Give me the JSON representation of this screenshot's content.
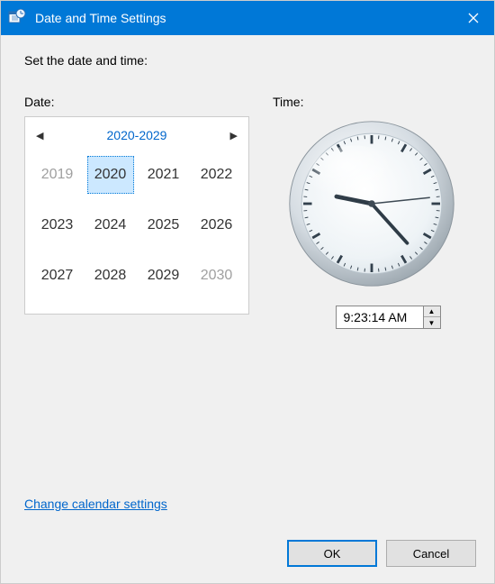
{
  "window": {
    "title": "Date and Time Settings"
  },
  "instruction": "Set the date and time:",
  "date": {
    "label": "Date:",
    "range_title": "2020-2029",
    "years": [
      "2019",
      "2020",
      "2021",
      "2022",
      "2023",
      "2024",
      "2025",
      "2026",
      "2027",
      "2028",
      "2029",
      "2030"
    ],
    "selected": "2020",
    "outside": [
      "2019",
      "2030"
    ]
  },
  "time": {
    "label": "Time:",
    "value": "9:23:14 AM",
    "hour": 9,
    "minute": 23,
    "second": 14
  },
  "link": "Change calendar settings",
  "buttons": {
    "ok": "OK",
    "cancel": "Cancel"
  }
}
